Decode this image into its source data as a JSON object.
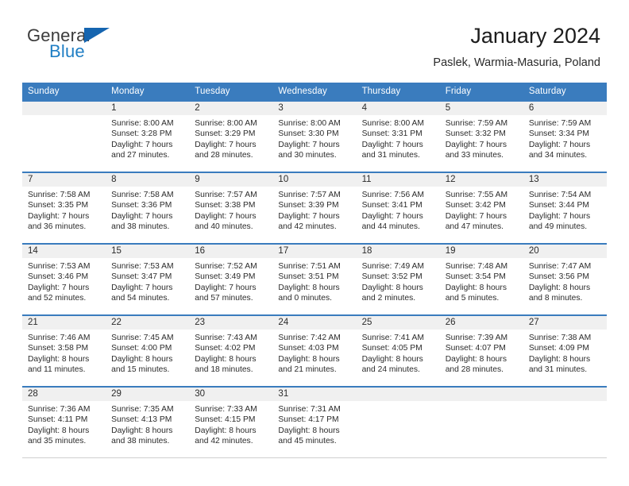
{
  "brand": {
    "name_top": "General",
    "name_bottom": "Blue",
    "triangle_icon": "triangle-icon",
    "colors": {
      "dark": "#3b3b3b",
      "blue": "#1f7ec4",
      "triangle": "#1565b0"
    }
  },
  "header": {
    "title": "January 2024",
    "subtitle": "Paslek, Warmia-Masuria, Poland"
  },
  "calendar": {
    "header_bg": "#3a7cbe",
    "daynum_bg": "#f0f0f0",
    "weekday_labels": [
      "Sunday",
      "Monday",
      "Tuesday",
      "Wednesday",
      "Thursday",
      "Friday",
      "Saturday"
    ],
    "labels": {
      "sunrise": "Sunrise:",
      "sunset": "Sunset:",
      "daylight": "Daylight:"
    },
    "weeks": [
      [
        {
          "day": "",
          "sunrise": "",
          "sunset": "",
          "daylight_line1": "",
          "daylight_line2": ""
        },
        {
          "day": "1",
          "sunrise": "Sunrise: 8:00 AM",
          "sunset": "Sunset: 3:28 PM",
          "daylight_line1": "Daylight: 7 hours",
          "daylight_line2": "and 27 minutes."
        },
        {
          "day": "2",
          "sunrise": "Sunrise: 8:00 AM",
          "sunset": "Sunset: 3:29 PM",
          "daylight_line1": "Daylight: 7 hours",
          "daylight_line2": "and 28 minutes."
        },
        {
          "day": "3",
          "sunrise": "Sunrise: 8:00 AM",
          "sunset": "Sunset: 3:30 PM",
          "daylight_line1": "Daylight: 7 hours",
          "daylight_line2": "and 30 minutes."
        },
        {
          "day": "4",
          "sunrise": "Sunrise: 8:00 AM",
          "sunset": "Sunset: 3:31 PM",
          "daylight_line1": "Daylight: 7 hours",
          "daylight_line2": "and 31 minutes."
        },
        {
          "day": "5",
          "sunrise": "Sunrise: 7:59 AM",
          "sunset": "Sunset: 3:32 PM",
          "daylight_line1": "Daylight: 7 hours",
          "daylight_line2": "and 33 minutes."
        },
        {
          "day": "6",
          "sunrise": "Sunrise: 7:59 AM",
          "sunset": "Sunset: 3:34 PM",
          "daylight_line1": "Daylight: 7 hours",
          "daylight_line2": "and 34 minutes."
        }
      ],
      [
        {
          "day": "7",
          "sunrise": "Sunrise: 7:58 AM",
          "sunset": "Sunset: 3:35 PM",
          "daylight_line1": "Daylight: 7 hours",
          "daylight_line2": "and 36 minutes."
        },
        {
          "day": "8",
          "sunrise": "Sunrise: 7:58 AM",
          "sunset": "Sunset: 3:36 PM",
          "daylight_line1": "Daylight: 7 hours",
          "daylight_line2": "and 38 minutes."
        },
        {
          "day": "9",
          "sunrise": "Sunrise: 7:57 AM",
          "sunset": "Sunset: 3:38 PM",
          "daylight_line1": "Daylight: 7 hours",
          "daylight_line2": "and 40 minutes."
        },
        {
          "day": "10",
          "sunrise": "Sunrise: 7:57 AM",
          "sunset": "Sunset: 3:39 PM",
          "daylight_line1": "Daylight: 7 hours",
          "daylight_line2": "and 42 minutes."
        },
        {
          "day": "11",
          "sunrise": "Sunrise: 7:56 AM",
          "sunset": "Sunset: 3:41 PM",
          "daylight_line1": "Daylight: 7 hours",
          "daylight_line2": "and 44 minutes."
        },
        {
          "day": "12",
          "sunrise": "Sunrise: 7:55 AM",
          "sunset": "Sunset: 3:42 PM",
          "daylight_line1": "Daylight: 7 hours",
          "daylight_line2": "and 47 minutes."
        },
        {
          "day": "13",
          "sunrise": "Sunrise: 7:54 AM",
          "sunset": "Sunset: 3:44 PM",
          "daylight_line1": "Daylight: 7 hours",
          "daylight_line2": "and 49 minutes."
        }
      ],
      [
        {
          "day": "14",
          "sunrise": "Sunrise: 7:53 AM",
          "sunset": "Sunset: 3:46 PM",
          "daylight_line1": "Daylight: 7 hours",
          "daylight_line2": "and 52 minutes."
        },
        {
          "day": "15",
          "sunrise": "Sunrise: 7:53 AM",
          "sunset": "Sunset: 3:47 PM",
          "daylight_line1": "Daylight: 7 hours",
          "daylight_line2": "and 54 minutes."
        },
        {
          "day": "16",
          "sunrise": "Sunrise: 7:52 AM",
          "sunset": "Sunset: 3:49 PM",
          "daylight_line1": "Daylight: 7 hours",
          "daylight_line2": "and 57 minutes."
        },
        {
          "day": "17",
          "sunrise": "Sunrise: 7:51 AM",
          "sunset": "Sunset: 3:51 PM",
          "daylight_line1": "Daylight: 8 hours",
          "daylight_line2": "and 0 minutes."
        },
        {
          "day": "18",
          "sunrise": "Sunrise: 7:49 AM",
          "sunset": "Sunset: 3:52 PM",
          "daylight_line1": "Daylight: 8 hours",
          "daylight_line2": "and 2 minutes."
        },
        {
          "day": "19",
          "sunrise": "Sunrise: 7:48 AM",
          "sunset": "Sunset: 3:54 PM",
          "daylight_line1": "Daylight: 8 hours",
          "daylight_line2": "and 5 minutes."
        },
        {
          "day": "20",
          "sunrise": "Sunrise: 7:47 AM",
          "sunset": "Sunset: 3:56 PM",
          "daylight_line1": "Daylight: 8 hours",
          "daylight_line2": "and 8 minutes."
        }
      ],
      [
        {
          "day": "21",
          "sunrise": "Sunrise: 7:46 AM",
          "sunset": "Sunset: 3:58 PM",
          "daylight_line1": "Daylight: 8 hours",
          "daylight_line2": "and 11 minutes."
        },
        {
          "day": "22",
          "sunrise": "Sunrise: 7:45 AM",
          "sunset": "Sunset: 4:00 PM",
          "daylight_line1": "Daylight: 8 hours",
          "daylight_line2": "and 15 minutes."
        },
        {
          "day": "23",
          "sunrise": "Sunrise: 7:43 AM",
          "sunset": "Sunset: 4:02 PM",
          "daylight_line1": "Daylight: 8 hours",
          "daylight_line2": "and 18 minutes."
        },
        {
          "day": "24",
          "sunrise": "Sunrise: 7:42 AM",
          "sunset": "Sunset: 4:03 PM",
          "daylight_line1": "Daylight: 8 hours",
          "daylight_line2": "and 21 minutes."
        },
        {
          "day": "25",
          "sunrise": "Sunrise: 7:41 AM",
          "sunset": "Sunset: 4:05 PM",
          "daylight_line1": "Daylight: 8 hours",
          "daylight_line2": "and 24 minutes."
        },
        {
          "day": "26",
          "sunrise": "Sunrise: 7:39 AM",
          "sunset": "Sunset: 4:07 PM",
          "daylight_line1": "Daylight: 8 hours",
          "daylight_line2": "and 28 minutes."
        },
        {
          "day": "27",
          "sunrise": "Sunrise: 7:38 AM",
          "sunset": "Sunset: 4:09 PM",
          "daylight_line1": "Daylight: 8 hours",
          "daylight_line2": "and 31 minutes."
        }
      ],
      [
        {
          "day": "28",
          "sunrise": "Sunrise: 7:36 AM",
          "sunset": "Sunset: 4:11 PM",
          "daylight_line1": "Daylight: 8 hours",
          "daylight_line2": "and 35 minutes."
        },
        {
          "day": "29",
          "sunrise": "Sunrise: 7:35 AM",
          "sunset": "Sunset: 4:13 PM",
          "daylight_line1": "Daylight: 8 hours",
          "daylight_line2": "and 38 minutes."
        },
        {
          "day": "30",
          "sunrise": "Sunrise: 7:33 AM",
          "sunset": "Sunset: 4:15 PM",
          "daylight_line1": "Daylight: 8 hours",
          "daylight_line2": "and 42 minutes."
        },
        {
          "day": "31",
          "sunrise": "Sunrise: 7:31 AM",
          "sunset": "Sunset: 4:17 PM",
          "daylight_line1": "Daylight: 8 hours",
          "daylight_line2": "and 45 minutes."
        },
        {
          "day": "",
          "sunrise": "",
          "sunset": "",
          "daylight_line1": "",
          "daylight_line2": ""
        },
        {
          "day": "",
          "sunrise": "",
          "sunset": "",
          "daylight_line1": "",
          "daylight_line2": ""
        },
        {
          "day": "",
          "sunrise": "",
          "sunset": "",
          "daylight_line1": "",
          "daylight_line2": ""
        }
      ]
    ]
  }
}
